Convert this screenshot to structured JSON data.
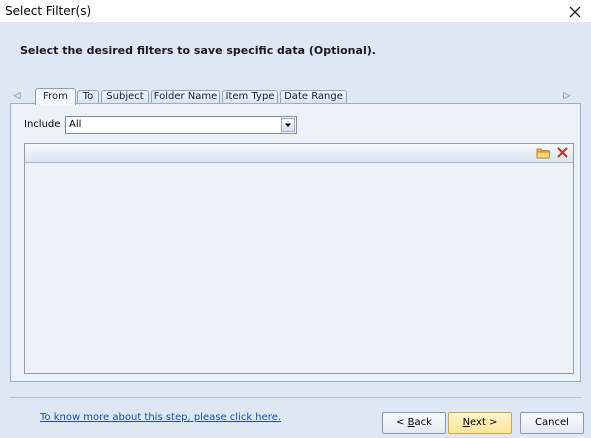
{
  "window": {
    "title": "Select Filter(s)",
    "close_icon": "close-icon"
  },
  "instruction": "Select the desired filters to save specific data (Optional).",
  "tabs": {
    "scroll_left_icon": "◁",
    "scroll_right_icon": "▷",
    "items": [
      {
        "label": "From",
        "active": true
      },
      {
        "label": "To",
        "active": false
      },
      {
        "label": "Subject",
        "active": false
      },
      {
        "label": "Folder Name",
        "active": false
      },
      {
        "label": "Item Type",
        "active": false
      },
      {
        "label": "Date Range",
        "active": false
      }
    ]
  },
  "filter": {
    "include_label": "Include :",
    "include_value": "All"
  },
  "panel": {
    "tools": [
      "open-folder-icon",
      "delete-icon"
    ]
  },
  "footer": {
    "help_link": "To know more about this step, please click here.",
    "back_prefix": "< ",
    "back_mnemonic": "B",
    "back_rest": "ack",
    "next_mnemonic": "N",
    "next_rest": "ext >",
    "cancel_label": "Cancel"
  },
  "colors": {
    "background": "#dde8f4",
    "link": "#1a4fa8",
    "next_button": "#fde597",
    "delete_icon": "#d0321d",
    "folder_icon": "#e8b74a"
  }
}
